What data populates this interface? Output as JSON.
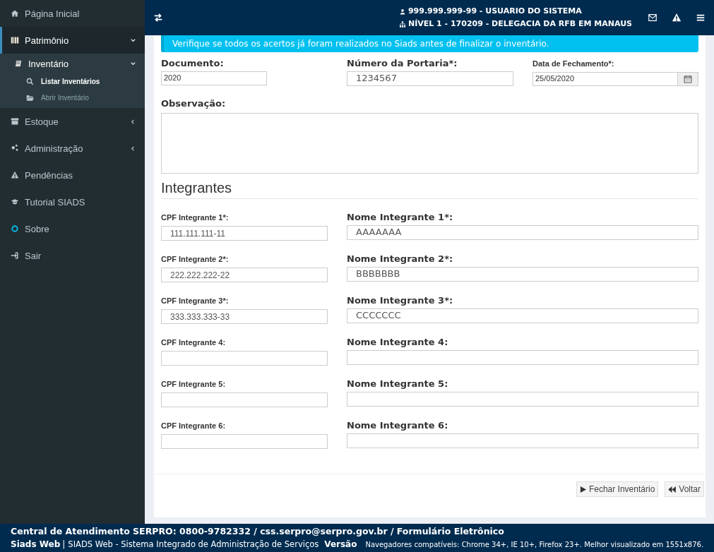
{
  "sidebar": {
    "items": [
      {
        "kind": "home",
        "label": "Página Inicial"
      },
      {
        "kind": "books",
        "label": "Patrimônio",
        "expanded": true,
        "children": [
          {
            "kind": "book",
            "label": "Inventário",
            "expanded": true,
            "children": [
              {
                "kind": "search",
                "label": "Listar Inventários",
                "selected": true
              },
              {
                "kind": "folder",
                "label": "Abrir Inventário",
                "selected": false
              }
            ]
          }
        ]
      },
      {
        "kind": "archive",
        "label": "Estoque",
        "expanded": false
      },
      {
        "kind": "gears",
        "label": "Administração",
        "expanded": false
      },
      {
        "kind": "warning",
        "label": "Pendências"
      },
      {
        "kind": "cap",
        "label": "Tutorial SIADS"
      },
      {
        "kind": "circle",
        "label": "Sobre"
      },
      {
        "kind": "exit",
        "label": "Sair"
      }
    ]
  },
  "header": {
    "user": "999.999.999-99 - USUARIO DO SISTEMA",
    "unit": "NÍVEL 1 - 170209 - DELEGACIA DA RFB EM MANAUS"
  },
  "alert": "Verifique se todos os acertos já foram realizados no Siads antes de finalizar o inventário.",
  "form": {
    "documento": {
      "label": "Documento:",
      "value": "2020"
    },
    "portaria": {
      "label": "Número da Portaria*:",
      "value": "1234567"
    },
    "data": {
      "label": "Data de Fechamento*:",
      "value": "25/05/2020"
    },
    "observacao": {
      "label": "Observação:"
    }
  },
  "integrantes": {
    "title": "Integrantes",
    "rows": [
      {
        "cpf_label": "CPF Integrante 1*:",
        "cpf": "111.111.111-11",
        "nome_label": "Nome Integrante 1*:",
        "nome": "AAAAAAA"
      },
      {
        "cpf_label": "CPF Integrante 2*:",
        "cpf": "222.222.222-22",
        "nome_label": "Nome Integrante 2*:",
        "nome": "BBBBBBB"
      },
      {
        "cpf_label": "CPF Integrante 3*:",
        "cpf": "333.333.333-33",
        "nome_label": "Nome Integrante 3*:",
        "nome": "CCCCCCC"
      },
      {
        "cpf_label": "CPF Integrante 4:",
        "cpf": "",
        "nome_label": "Nome Integrante 4:",
        "nome": ""
      },
      {
        "cpf_label": "CPF Integrante 5:",
        "cpf": "",
        "nome_label": "Nome Integrante 5:",
        "nome": ""
      },
      {
        "cpf_label": "CPF Integrante 6:",
        "cpf": "",
        "nome_label": "Nome Integrante 6:",
        "nome": ""
      }
    ]
  },
  "buttons": [
    "Fechar Inventário",
    "Voltar"
  ],
  "footer": {
    "line1": "Central de Atendimento SERPRO: 0800-9782332 / css.serpro@serpro.gov.br / Formulário Eletrônico",
    "brand": "Siads Web",
    "separator": "|",
    "system": "SIADS Web - Sistema Integrado de Administração de Serviços",
    "version": "Versão",
    "browsers": "Navegadores compatíveis: Chrome 34+, IE 10+, Firefox 23+. Melhor visualizado em 1551x876."
  }
}
